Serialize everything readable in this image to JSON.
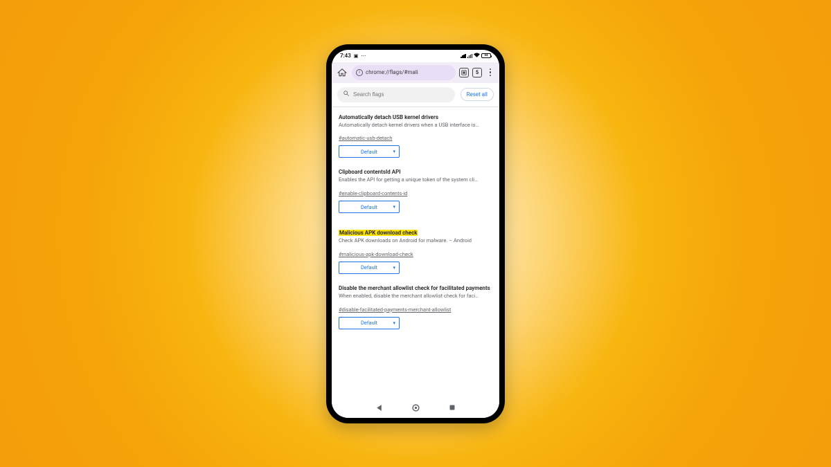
{
  "status": {
    "time": "7:43",
    "battery": "84"
  },
  "browser": {
    "url": "chrome://flags/#mali",
    "tabs_count": "5"
  },
  "search": {
    "placeholder": "Search flags",
    "reset_label": "Reset all"
  },
  "flags": [
    {
      "title": "Automatically detach USB kernel drivers",
      "desc": "Automatically detach kernel drivers when a USB interface is…",
      "anchor": "#automatic-usb-detach",
      "value": "Default",
      "highlighted": false
    },
    {
      "title": "Clipboard contentsId API",
      "desc": "Enables the API for getting a unique token of the system cli…",
      "anchor": "#enable-clipboard-contents-id",
      "value": "Default",
      "highlighted": false
    },
    {
      "title": "Malicious APK download check",
      "desc": "Check APK downloads on Android for malware. – Android",
      "anchor": "#malicious-apk-download-check",
      "value": "Default",
      "highlighted": true
    },
    {
      "title": "Disable the merchant allowlist check for facilitated payments",
      "desc": "When enabled, disable the merchant allowlist check for faci…",
      "anchor": "#disable-facilitated-payments-merchant-allowlist",
      "value": "Default",
      "highlighted": false
    }
  ]
}
